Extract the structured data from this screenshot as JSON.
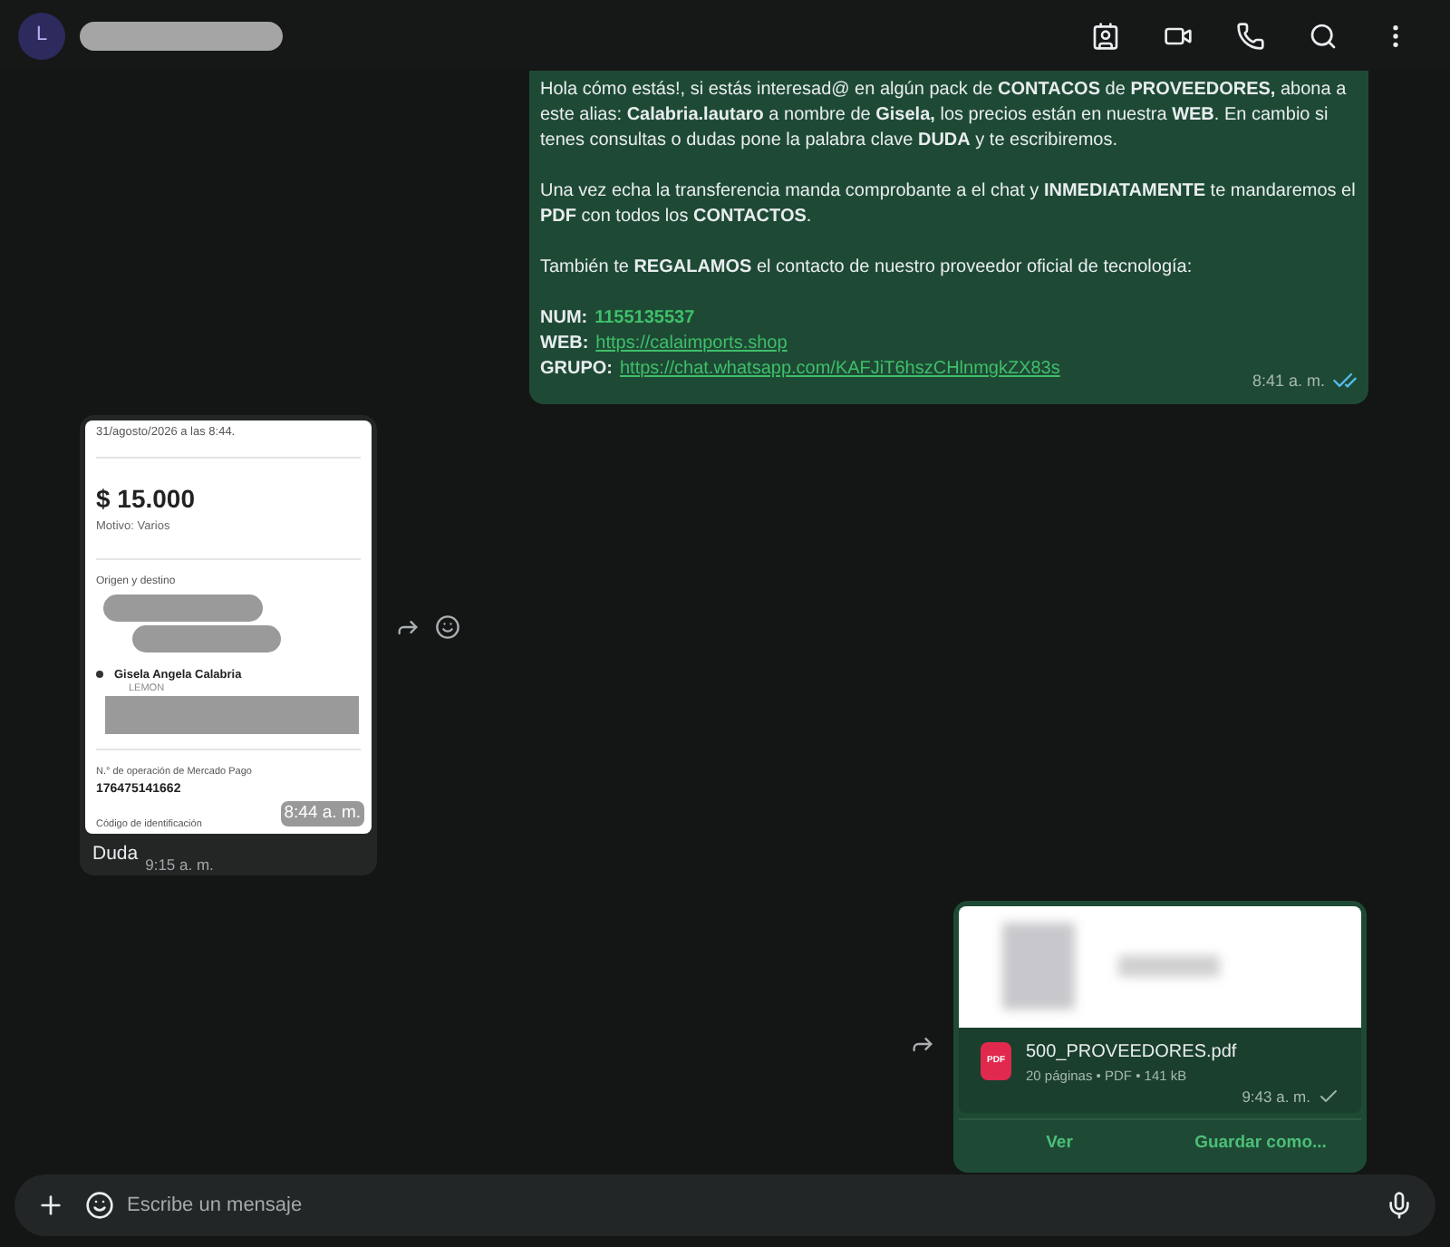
{
  "header": {
    "avatar_letter": "L"
  },
  "messages": [
    {
      "kind": "text",
      "outgoing": true,
      "paragraphs": [
        "Hola cómo estás!, si estás interesad@ en algún pack de **CONTACOS** de **PROVEEDORES,** abona a este alias: **Calabria.lautaro** a nombre de **Gisela,** los precios están en nuestra **WEB**. En cambio si tenes consultas o dudas pone la palabra clave **DUDA** y te escribiremos.",
        "Una vez echa la transferencia manda comprobante a el chat y **INMEDIATAMENTE** te mandaremos el **PDF** con todos los **CONTACTOS**.",
        "También te **REGALAMOS** el contacto de nuestro proveedor oficial de tecnología:"
      ],
      "contacts": [
        {
          "label": "NUM:",
          "value": "1155135537",
          "kind": "phone"
        },
        {
          "label": "WEB:",
          "value": "https://calaimports.shop",
          "kind": "link"
        },
        {
          "label": "GRUPO:",
          "value": "https://chat.whatsapp.com/KAFJiT6hszCHlnmgkZX83s",
          "kind": "link"
        }
      ],
      "time": "8:41 a. m.",
      "read": true
    },
    {
      "kind": "receipt",
      "outgoing": false,
      "date": "31/agosto/2026 a las 8:44.",
      "amount": "$ 15.000",
      "reason": "Motivo: Varios",
      "route_heading": "Origen y destino",
      "recipient": "Gisela Angela Calabria",
      "bank": "LEMON",
      "operation_label": "N.° de operación de Mercado Pago",
      "operation_number": "176475141662",
      "code_label": "Código de identificación",
      "time": "8:44 a. m.",
      "caption": "Duda",
      "caption_time": "9:15 a. m."
    },
    {
      "kind": "document",
      "outgoing": true,
      "file_name": "500_PROVEEDORES.pdf",
      "file_type": "PDF",
      "details": "20 páginas • PDF • 141 kB",
      "time": "9:43 a. m.",
      "read": false,
      "actions": [
        "Ver",
        "Guardar como..."
      ]
    }
  ],
  "composer": {
    "placeholder": "Escribe un mensaje"
  }
}
